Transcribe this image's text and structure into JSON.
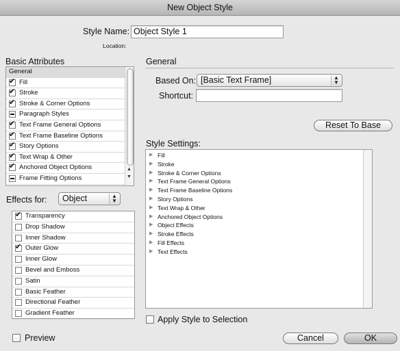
{
  "window": {
    "title": "New Object Style"
  },
  "style_name": {
    "label": "Style Name:",
    "value": "Object Style 1",
    "location_label": "Location:"
  },
  "basic_attributes": {
    "heading": "Basic Attributes",
    "items": [
      {
        "label": "General",
        "state": "header"
      },
      {
        "label": "Fill",
        "state": "checked"
      },
      {
        "label": "Stroke",
        "state": "checked"
      },
      {
        "label": "Stroke & Corner Options",
        "state": "checked"
      },
      {
        "label": "Paragraph Styles",
        "state": "mixed"
      },
      {
        "label": "Text Frame General Options",
        "state": "checked"
      },
      {
        "label": "Text Frame Baseline Options",
        "state": "checked"
      },
      {
        "label": "Story Options",
        "state": "checked"
      },
      {
        "label": "Text Wrap & Other",
        "state": "checked"
      },
      {
        "label": "Anchored Object Options",
        "state": "checked"
      },
      {
        "label": "Frame Fitting Options",
        "state": "mixed"
      }
    ]
  },
  "effects": {
    "label": "Effects for:",
    "selected": "Object",
    "items": [
      {
        "label": "Transparency",
        "state": "checked"
      },
      {
        "label": "Drop Shadow",
        "state": "unchecked"
      },
      {
        "label": "Inner Shadow",
        "state": "unchecked"
      },
      {
        "label": "Outer Glow",
        "state": "checked"
      },
      {
        "label": "Inner Glow",
        "state": "unchecked"
      },
      {
        "label": "Bevel and Emboss",
        "state": "unchecked"
      },
      {
        "label": "Satin",
        "state": "unchecked"
      },
      {
        "label": "Basic Feather",
        "state": "unchecked"
      },
      {
        "label": "Directional Feather",
        "state": "unchecked"
      },
      {
        "label": "Gradient Feather",
        "state": "unchecked"
      }
    ]
  },
  "general": {
    "heading": "General",
    "based_on_label": "Based On:",
    "based_on_value": "[Basic Text Frame]",
    "shortcut_label": "Shortcut:",
    "shortcut_value": "",
    "reset_button": "Reset To Base"
  },
  "style_settings": {
    "heading": "Style Settings:",
    "items": [
      "Fill",
      "Stroke",
      "Stroke & Corner Options",
      "Text Frame General Options",
      "Text Frame Baseline Options",
      "Story Options",
      "Text Wrap & Other",
      "Anchored Object Options",
      "Object Effects",
      "Stroke Effects",
      "Fill Effects",
      "Text Effects"
    ]
  },
  "apply_style": {
    "label": "Apply Style to Selection",
    "checked": false
  },
  "preview": {
    "label": "Preview",
    "checked": false
  },
  "buttons": {
    "cancel": "Cancel",
    "ok": "OK"
  },
  "colors": {
    "ok_button": "#c6c6c6",
    "header_row": "#dcdcdc",
    "window_bg": "#e8e8e8"
  }
}
